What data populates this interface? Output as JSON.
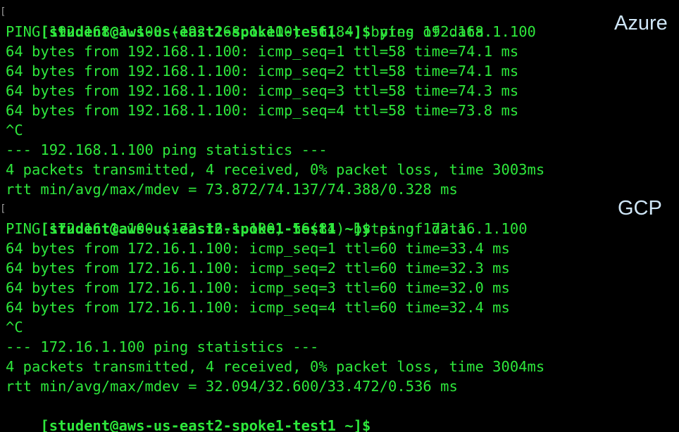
{
  "accent_color": "#2ee83c",
  "label_color": "#cfe6f7",
  "labels": {
    "azure": "Azure",
    "gcp": "GCP"
  },
  "azure_block": {
    "prompt": "[student@aws-us-east2-spoke1-test1 ~]$",
    "command": " ping 192.168.1.100",
    "header": "PING 192.168.1.100 (192.168.1.100) 56(84) bytes of data.",
    "replies": [
      "64 bytes from 192.168.1.100: icmp_seq=1 ttl=58 time=74.1 ms",
      "64 bytes from 192.168.1.100: icmp_seq=2 ttl=58 time=74.1 ms",
      "64 bytes from 192.168.1.100: icmp_seq=3 ttl=58 time=74.3 ms",
      "64 bytes from 192.168.1.100: icmp_seq=4 ttl=58 time=73.8 ms"
    ],
    "interrupt": "^C",
    "stats_header": "--- 192.168.1.100 ping statistics ---",
    "stats_packets": "4 packets transmitted, 4 received, 0% packet loss, time 3003ms",
    "stats_rtt": "rtt min/avg/max/mdev = 73.872/74.137/74.388/0.328 ms"
  },
  "gcp_block": {
    "prompt": "[student@aws-us-east2-spoke1-test1 ~]$",
    "command": " ping 172.16.1.100",
    "header": "PING 172.16.1.100 (172.16.1.100) 56(84) bytes of data.",
    "replies": [
      "64 bytes from 172.16.1.100: icmp_seq=1 ttl=60 time=33.4 ms",
      "64 bytes from 172.16.1.100: icmp_seq=2 ttl=60 time=32.3 ms",
      "64 bytes from 172.16.1.100: icmp_seq=3 ttl=60 time=32.0 ms",
      "64 bytes from 172.16.1.100: icmp_seq=4 ttl=60 time=32.4 ms"
    ],
    "interrupt": "^C",
    "stats_header": "--- 172.16.1.100 ping statistics ---",
    "stats_packets": "4 packets transmitted, 4 received, 0% packet loss, time 3004ms",
    "stats_rtt": "rtt min/avg/max/mdev = 32.094/32.600/33.472/0.536 ms"
  },
  "final_prompt": "[student@aws-us-east2-spoke1-test1 ~]$"
}
